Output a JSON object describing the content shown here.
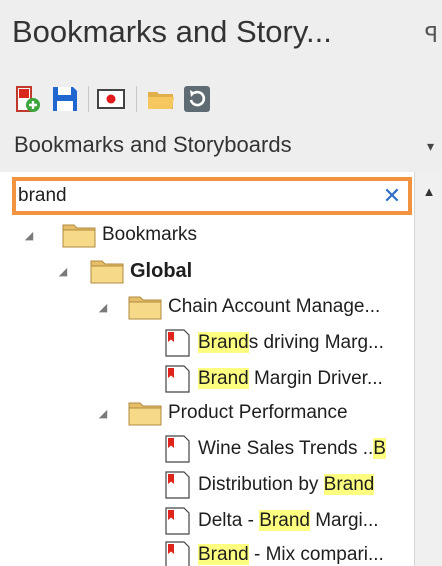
{
  "pane": {
    "title": "Bookmarks and Story...",
    "pin_glyph": "ꟼ"
  },
  "toolbar": {
    "buttons": [
      {
        "name": "new-bookmark-icon"
      },
      {
        "name": "save-icon"
      },
      {
        "name": "present-icon"
      },
      {
        "name": "open-folder-icon"
      },
      {
        "name": "refresh-icon"
      }
    ]
  },
  "view_selector": {
    "value": "Bookmarks and Storyboards",
    "arrow": "▾"
  },
  "search": {
    "value": "brand",
    "clear_glyph": "✕"
  },
  "scrollbar": {
    "up_glyph": "▲"
  },
  "tree": {
    "root": {
      "label": "Bookmarks",
      "expander": "◢"
    },
    "global": {
      "label": "Global",
      "expander": "◢"
    },
    "chain": {
      "label": "Chain Account Manage...",
      "expander": "◢",
      "items": [
        {
          "match": "Brand",
          "rest": "s driving Marg..."
        },
        {
          "match": "Brand",
          "rest": " Margin Driver..."
        }
      ]
    },
    "product": {
      "label": "Product Performance",
      "expander": "◢",
      "items": [
        {
          "pre": "Wine Sales Trends ..",
          "match": "B"
        },
        {
          "pre": "Distribution by ",
          "match": "Brand"
        },
        {
          "pre": "Delta - ",
          "match": "Brand",
          "rest": " Margi..."
        },
        {
          "match": "Brand",
          "rest": " - Mix compari..."
        }
      ]
    }
  },
  "colors": {
    "search_outline": "#f3923f",
    "highlight": "#ffff80",
    "folder": "#f7d98a",
    "pane_bg": "#eeeeee"
  }
}
